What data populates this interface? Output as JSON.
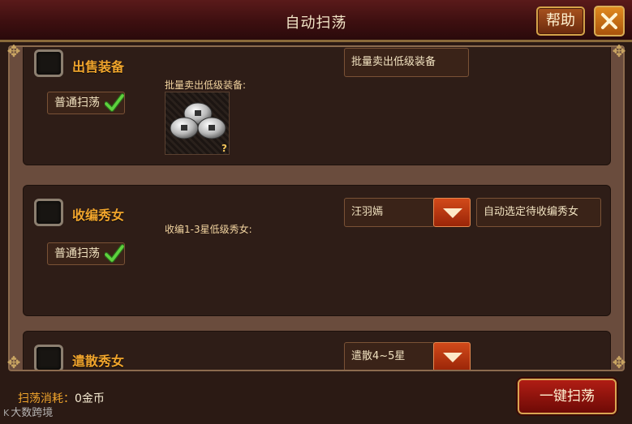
{
  "window": {
    "title": "自动扫荡",
    "help_label": "帮助"
  },
  "sections": [
    {
      "title": "出售装备",
      "sweep_chip": "普通扫荡",
      "description": "批量卖出低级装备:",
      "action_button": "批量卖出低级装备",
      "item_badge": "?"
    },
    {
      "title": "收编秀女",
      "sweep_chip": "普通扫荡",
      "description": "收编1-3星低级秀女:",
      "dropdown_value": "汪羽嫣",
      "action_button": "自动选定待收编秀女"
    },
    {
      "title": "遣散秀女",
      "dropdown_value": "遣散4~5星"
    }
  ],
  "footer": {
    "cost_label": "扫荡消耗：",
    "cost_value": "0金币",
    "sweep_all_label": "一键扫荡"
  },
  "watermark": {
    "logo": "K",
    "text": "大数跨境"
  },
  "colors": {
    "accent_orange": "#f0a42c",
    "title_bar": "#3d0f10",
    "section_bg": "#2e1d17",
    "button_red": "#b01d14",
    "check_green": "#4fc03a"
  },
  "icons": [
    "close-icon",
    "checkmark-icon",
    "chevron-down-icon",
    "silver-coins-icon",
    "corner-ornament-icon"
  ]
}
